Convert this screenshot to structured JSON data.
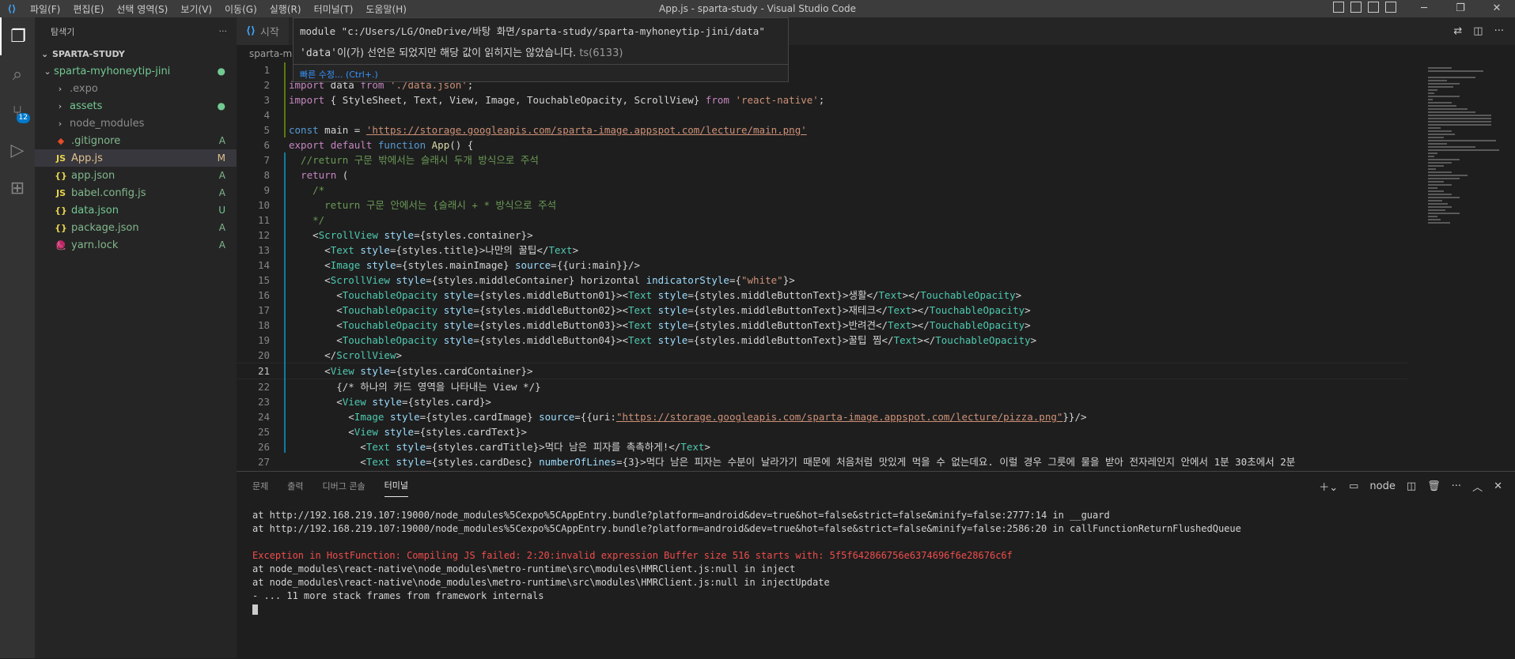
{
  "titlebar": {
    "menu": [
      "파일(F)",
      "편집(E)",
      "선택 영역(S)",
      "보기(V)",
      "이동(G)",
      "실행(R)",
      "터미널(T)",
      "도움말(H)"
    ],
    "title": "App.js - sparta-study - Visual Studio Code",
    "min": "─",
    "restore": "❐",
    "close": "✕"
  },
  "activity": {
    "scm_badge": "12"
  },
  "sidebar": {
    "header": "탐색기",
    "more": "···",
    "section": "SPARTA-STUDY",
    "root": "sparta-myhoneytip-jini",
    "items": [
      {
        "label": ".expo",
        "type": "folder",
        "status": ""
      },
      {
        "label": "assets",
        "type": "folder",
        "status": "●"
      },
      {
        "label": "node_modules",
        "type": "folder",
        "status": ""
      },
      {
        "label": ".gitignore",
        "type": "git",
        "status": "A"
      },
      {
        "label": "App.js",
        "type": "js",
        "status": "M"
      },
      {
        "label": "app.json",
        "type": "json",
        "status": "A"
      },
      {
        "label": "babel.config.js",
        "type": "js",
        "status": "A"
      },
      {
        "label": "data.json",
        "type": "json",
        "status": "U"
      },
      {
        "label": "package.json",
        "type": "json",
        "status": "A"
      },
      {
        "label": "yarn.lock",
        "type": "lock",
        "status": "A"
      }
    ]
  },
  "editor": {
    "tab_label": "시작",
    "breadcrumb": "sparta-m",
    "hover": {
      "module_line": "module \"c:/Users/LG/OneDrive/바탕 화면/sparta-study/sparta-myhoneytip-jini/data\"",
      "message_prefix": "'data'",
      "message_body": "이(가) 선언은 되었지만 해당 값이 읽히지는 않았습니다.",
      "message_code": "ts(6133)",
      "quick_fix": "빠른 수정... (Ctrl+.)"
    },
    "lines": [
      {
        "n": "1",
        "text": ""
      },
      {
        "n": "2",
        "text": "import data from './data.json';"
      },
      {
        "n": "3",
        "text": "import { StyleSheet, Text, View, Image, TouchableOpacity, ScrollView} from 'react-native';"
      },
      {
        "n": "4",
        "text": ""
      },
      {
        "n": "5",
        "text": "const main = 'https://storage.googleapis.com/sparta-image.appspot.com/lecture/main.png'"
      },
      {
        "n": "6",
        "text": "export default function App() {"
      },
      {
        "n": "7",
        "text": "  //return 구문 밖에서는 슬래시 두개 방식으로 주석"
      },
      {
        "n": "8",
        "text": "  return ("
      },
      {
        "n": "9",
        "text": "    /*"
      },
      {
        "n": "10",
        "text": "      return 구문 안에서는 {슬래시 + * 방식으로 주석"
      },
      {
        "n": "11",
        "text": "    */"
      },
      {
        "n": "12",
        "text": "    <ScrollView style={styles.container}>"
      },
      {
        "n": "13",
        "text": "      <Text style={styles.title}>나만의 꿀팁</Text>"
      },
      {
        "n": "14",
        "text": "      <Image style={styles.mainImage} source={{uri:main}}/>"
      },
      {
        "n": "15",
        "text": "      <ScrollView style={styles.middleContainer} horizontal indicatorStyle={\"white\"}>"
      },
      {
        "n": "16",
        "text": "        <TouchableOpacity style={styles.middleButton01}><Text style={styles.middleButtonText}>생활</Text></TouchableOpacity>"
      },
      {
        "n": "17",
        "text": "        <TouchableOpacity style={styles.middleButton02}><Text style={styles.middleButtonText}>재테크</Text></TouchableOpacity>"
      },
      {
        "n": "18",
        "text": "        <TouchableOpacity style={styles.middleButton03}><Text style={styles.middleButtonText}>반려견</Text></TouchableOpacity>"
      },
      {
        "n": "19",
        "text": "        <TouchableOpacity style={styles.middleButton04}><Text style={styles.middleButtonText}>꿀팁 찜</Text></TouchableOpacity>"
      },
      {
        "n": "20",
        "text": "      </ScrollView>"
      },
      {
        "n": "21",
        "text": "      <View style={styles.cardContainer}>"
      },
      {
        "n": "22",
        "text": "        {/* 하나의 카드 영역을 나타내는 View */}"
      },
      {
        "n": "23",
        "text": "        <View style={styles.card}>"
      },
      {
        "n": "24",
        "text": "          <Image style={styles.cardImage} source={{uri:\"https://storage.googleapis.com/sparta-image.appspot.com/lecture/pizza.png\"}}/>"
      },
      {
        "n": "25",
        "text": "          <View style={styles.cardText}>"
      },
      {
        "n": "26",
        "text": "            <Text style={styles.cardTitle}>먹다 남은 피자를 촉촉하게!</Text>"
      },
      {
        "n": "27",
        "text": "            <Text style={styles.cardDesc} numberOfLines={3}>먹다 남은 피자는 수분이 날라가기 때문에 처음처럼 맛있게 먹을 수 없는데요. 이럴 경우 그릇에 물을 받아 전자레인지 안에서 1분 30초에서 2분"
      }
    ]
  },
  "panel": {
    "tabs": [
      "문제",
      "출력",
      "디버그 콘솔",
      "터미널"
    ],
    "active_tab": "터미널",
    "shell": "node",
    "terminal_lines": [
      {
        "text": "at http://192.168.219.107:19000/node_modules%5Cexpo%5CAppEntry.bundle?platform=android&dev=true&hot=false&strict=false&minify=false:2777:14 in __guard",
        "kind": "normal"
      },
      {
        "text": "at http://192.168.219.107:19000/node_modules%5Cexpo%5CAppEntry.bundle?platform=android&dev=true&hot=false&strict=false&minify=false:2586:20 in callFunctionReturnFlushedQueue",
        "kind": "normal"
      },
      {
        "text": "",
        "kind": "normal"
      },
      {
        "text": "Exception in HostFunction: Compiling JS failed: 2:20:invalid expression Buffer size 516 starts with: 5f5f642866756e6374696f6e28676c6f",
        "kind": "err"
      },
      {
        "text": "at node_modules\\react-native\\node_modules\\metro-runtime\\src\\modules\\HMRClient.js:null in inject",
        "kind": "normal"
      },
      {
        "text": "at node_modules\\react-native\\node_modules\\metro-runtime\\src\\modules\\HMRClient.js:null in injectUpdate",
        "kind": "normal"
      },
      {
        "text": "- ... 11 more stack frames from framework internals",
        "kind": "normal"
      }
    ]
  }
}
